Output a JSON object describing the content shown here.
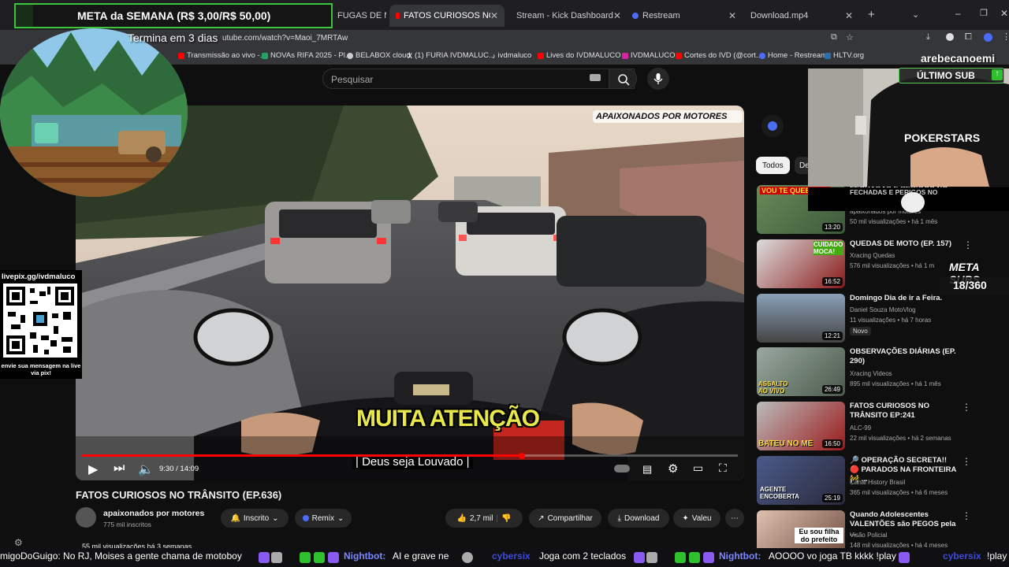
{
  "browser": {
    "tabs": [
      {
        "label": "FUGAS DE M"
      },
      {
        "label": "FATOS CURIOSOS NO TRÂNSITO"
      },
      {
        "label": "Stream - Kick Dashboard"
      },
      {
        "label": "Restream"
      },
      {
        "label": "Download.mp4"
      }
    ],
    "url": "utube.com/watch?v=Maoi_7MRTAw",
    "bookmarks": [
      "Transmissão ao vivo -...",
      "NOVAs RIFA 2025 - Pl...",
      "BELABOX cloud",
      "(1) FURIA IVDMALUC...",
      "ivdmaluco",
      "Lives do IVDMALUCO ...",
      "IVDMALUCO",
      "Cortes do IVD (@cort...",
      "Home - Restream",
      "HLTV.org"
    ]
  },
  "youtube": {
    "search_placeholder": "Pesquisar",
    "player": {
      "time": "9:30 / 14:09",
      "progress_fraction": 0.671,
      "caption_main": "MUITA ATENÇÃO",
      "caption_sub": "| Deus seja Louvado |",
      "watermark": "APAIXONADOS POR MOTORES"
    },
    "video": {
      "title": "FATOS CURIOSOS NO TRÂNSITO (EP.636)",
      "channel": "apaixonados por motores",
      "subscribers": "775 mil inscritos",
      "subscribe_label": "Inscrito",
      "remix_label": "Remix",
      "likes": "2,7 mil",
      "share_label": "Compartilhar",
      "download_label": "Download",
      "thanks_label": "Valeu",
      "views_line": "55 mil visualizações  há 3 semanas"
    },
    "chips": [
      "Todos",
      "De"
    ],
    "recommendations": [
      {
        "title": "FECHADAS E PERIGOS NO",
        "channel": "apaixonados por motores",
        "meta": "50 mil visualizações • há 1 mês",
        "duration": "13:20",
        "badge": "",
        "thumb_text": "VOU TE QUEBRAR!"
      },
      {
        "title": "QUEDAS DE MOTO (EP. 157)",
        "channel": "Xracing Quedas",
        "meta": "576 mil visualizações • há 1 m",
        "duration": "16:52",
        "badge": "",
        "thumb_text": "CUIDADO MOCA!"
      },
      {
        "title": "Domingo Dia de ir a Feira.",
        "channel": "Daniel Souza MotoVlog",
        "meta": "11 visualizações • há 7 horas",
        "duration": "12:21",
        "badge": "Novo",
        "thumb_text": ""
      },
      {
        "title": "OBSERVAÇÕES DIÁRIAS (EP. 290)",
        "channel": "Xracing Videos",
        "meta": "895 mil visualizações • há 1 mês",
        "duration": "26:49",
        "badge": "",
        "thumb_text": "ASSALTO AO VIVO"
      },
      {
        "title": "FATOS CURIOSOS NO TRÂNSITO EP:241",
        "channel": "ALC-99",
        "meta": "22 mil visualizações • há 2 semanas",
        "duration": "16:50",
        "badge": "",
        "thumb_text": "BATEU NO ME"
      },
      {
        "title": "🔎 OPERAÇÃO SECRETA!! 🔴 PARADOS NA FRONTEIRA 🚧 ...",
        "channel": "Canal History Brasil",
        "meta": "365 mil visualizações • há 6 meses",
        "duration": "25:19",
        "badge": "",
        "thumb_text": "AGENTE ENCOBERTA"
      },
      {
        "title": "Quando Adolescentes VALENTÕES são PEGOS pela ...",
        "channel": "Visão Policial",
        "meta": "148 mil visualizações • há 4 meses",
        "duration": "",
        "badge": "",
        "thumb_text": "Eu sou filha do prefeito"
      }
    ]
  },
  "overlay": {
    "meta_banner": "META da SEMANA (R$ 3,00/R$ 50,00)",
    "meta_countdown": "Termina em 3 dias",
    "qr_url": "livepix.gg/ivdmaluco",
    "qr_message": "envie sua mensagem na live via pix!",
    "streamer_name": "arebecanoemi",
    "ultimo_sub_label": "ÚLTIMO SUB",
    "meta_subs_label": "META SUBS",
    "meta_subs_value": "18/360",
    "webcam_brand": "POKERSTARS"
  },
  "chat": [
    {
      "user": "",
      "text": "migoDoGuigo: No RJ, Moises a gente chama de motoboy"
    },
    {
      "user": "Nightbot:",
      "text": "AI e grave ne"
    },
    {
      "user": "cybersix",
      "text": "Joga com 2 teclados"
    },
    {
      "user": "Nightbot:",
      "text": "AOOOO vo joga TB kkkk !play"
    },
    {
      "user": "cybersix",
      "text": "!play"
    }
  ],
  "colors": {
    "accent_red": "#ff0000",
    "overlay_green": "#2fbf2f",
    "chat_user": "#7a88ff"
  }
}
